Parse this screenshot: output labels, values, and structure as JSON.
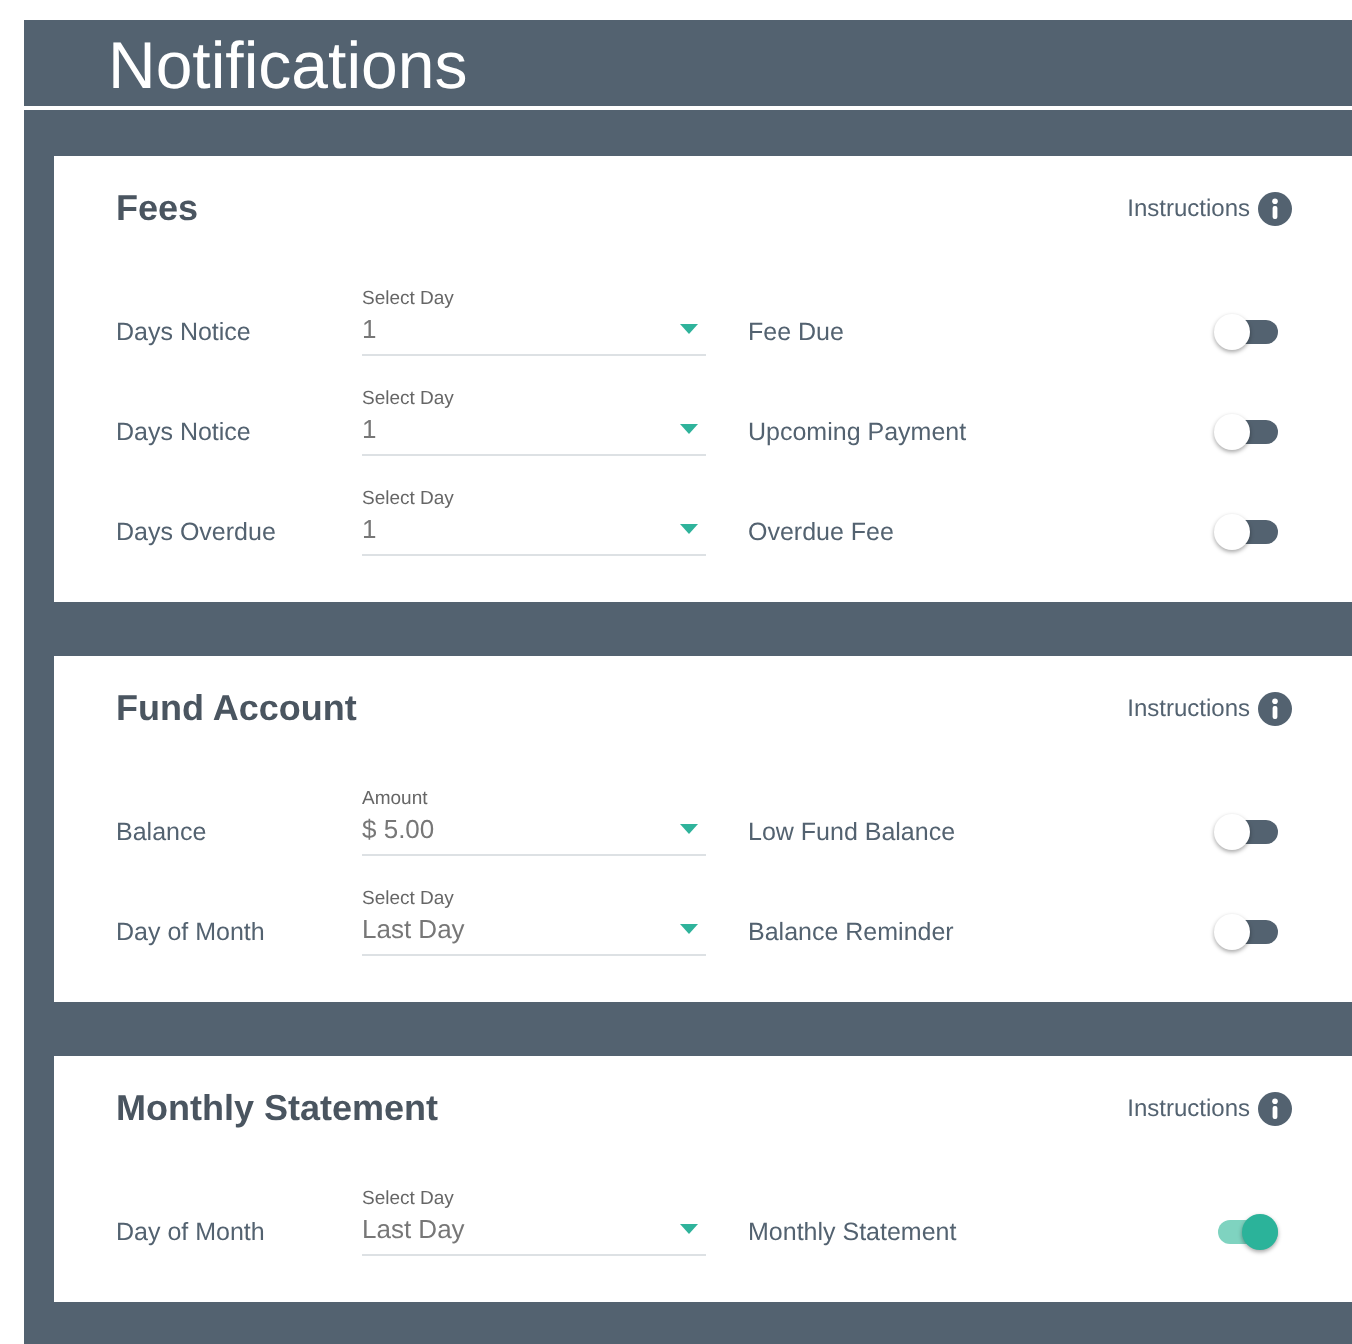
{
  "header": {
    "title": "Notifications"
  },
  "sections": [
    {
      "title": "Fees",
      "instructions": "Instructions",
      "rows": [
        {
          "label": "Days Notice",
          "field_label": "Select Day",
          "value": "1",
          "toggle_label": "Fee Due",
          "on": false
        },
        {
          "label": "Days Notice",
          "field_label": "Select Day",
          "value": "1",
          "toggle_label": "Upcoming Payment",
          "on": false
        },
        {
          "label": "Days Overdue",
          "field_label": "Select Day",
          "value": "1",
          "toggle_label": "Overdue Fee",
          "on": false
        }
      ]
    },
    {
      "title": "Fund Account",
      "instructions": "Instructions",
      "rows": [
        {
          "label": "Balance",
          "field_label": "Amount",
          "value": "$ 5.00",
          "toggle_label": "Low Fund Balance",
          "on": false
        },
        {
          "label": "Day of Month",
          "field_label": "Select Day",
          "value": "Last Day",
          "toggle_label": "Balance Reminder",
          "on": false
        }
      ]
    },
    {
      "title": "Monthly Statement",
      "instructions": "Instructions",
      "rows": [
        {
          "label": "Day of Month",
          "field_label": "Select Day",
          "value": "Last Day",
          "toggle_label": "Monthly Statement",
          "on": true
        }
      ]
    }
  ]
}
